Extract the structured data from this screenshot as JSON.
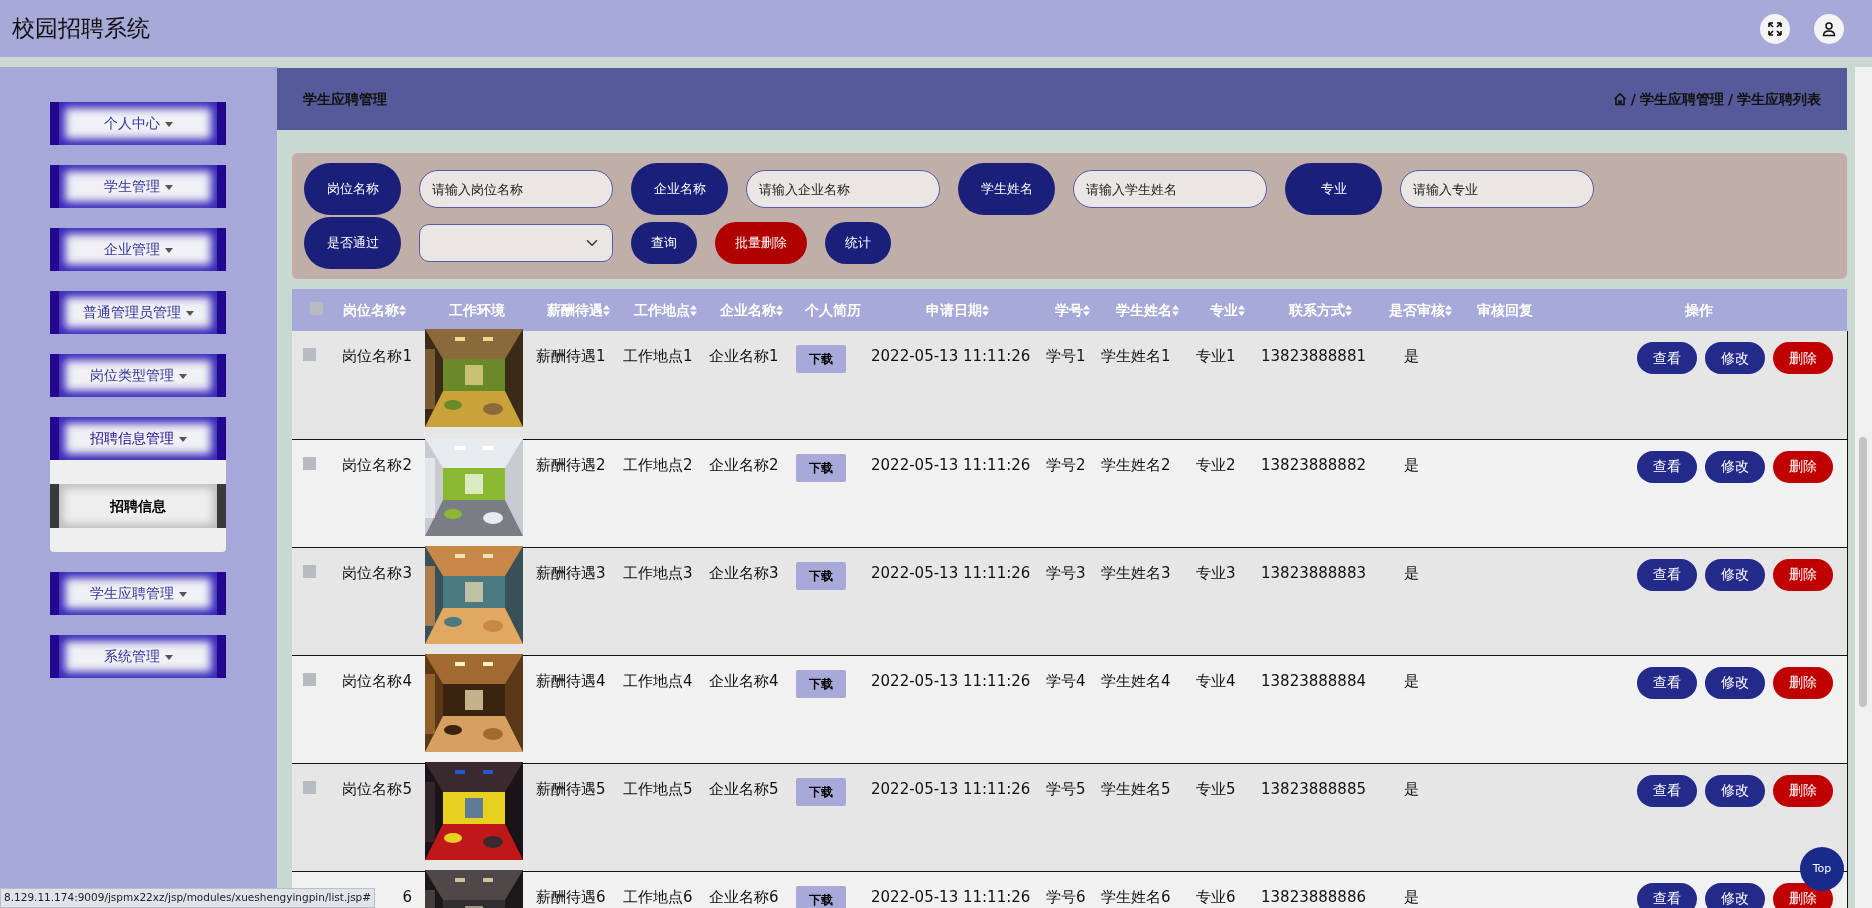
{
  "app_title": "校园招聘系统",
  "sidebar": {
    "menus": [
      {
        "label": "个人中心"
      },
      {
        "label": "学生管理"
      },
      {
        "label": "企业管理"
      },
      {
        "label": "普通管理员管理"
      },
      {
        "label": "岗位类型管理"
      },
      {
        "label": "招聘信息管理",
        "children": [
          {
            "label": "招聘信息",
            "hovered": true
          }
        ]
      },
      {
        "label": "学生应聘管理"
      },
      {
        "label": "系统管理"
      }
    ]
  },
  "page_header": {
    "title": "学生应聘管理",
    "separator": "/",
    "breadcrumb": [
      "学生应聘管理",
      "学生应聘列表"
    ]
  },
  "filters": [
    {
      "label": "岗位名称",
      "kind": "text",
      "placeholder": "请输入岗位名称"
    },
    {
      "label": "企业名称",
      "kind": "text",
      "placeholder": "请输入企业名称"
    },
    {
      "label": "学生姓名",
      "kind": "text",
      "placeholder": "请输入学生姓名"
    },
    {
      "label": "专业",
      "kind": "text",
      "placeholder": "请输入专业"
    },
    {
      "label": "是否通过",
      "kind": "select"
    }
  ],
  "filter_buttons": [
    {
      "label": "查询",
      "kind": "primary"
    },
    {
      "label": "批量删除",
      "kind": "danger"
    },
    {
      "label": "统计",
      "kind": "primary"
    }
  ],
  "table": {
    "select_all_checked": false,
    "columns": [
      {
        "label": "岗位名称",
        "sortable": true
      },
      {
        "label": "工作环境",
        "sortable": false
      },
      {
        "label": "薪酬待遇",
        "sortable": true
      },
      {
        "label": "工作地点",
        "sortable": true
      },
      {
        "label": "企业名称",
        "sortable": true
      },
      {
        "label": "个人简历",
        "sortable": false
      },
      {
        "label": "申请日期",
        "sortable": true
      },
      {
        "label": "学号",
        "sortable": true
      },
      {
        "label": "学生姓名",
        "sortable": true
      },
      {
        "label": "专业",
        "sortable": true
      },
      {
        "label": "联系方式",
        "sortable": true
      },
      {
        "label": "是否审核",
        "sortable": true
      },
      {
        "label": "审核回复",
        "sortable": false
      },
      {
        "label": "操作",
        "sortable": false
      }
    ],
    "rows": [
      {
        "checked": false,
        "post": "岗位名称1",
        "salary": "薪酬待遇1",
        "location": "工作地点1",
        "company": "企业名称1",
        "resume": "下载",
        "date": "2022-05-13 11:11:26",
        "student_no": "学号1",
        "student_name": "学生姓名1",
        "major": "专业1",
        "phone": "13823888881",
        "reviewed": "是",
        "actions": [
          {
            "label": "查看",
            "kind": "primary"
          },
          {
            "label": "修改",
            "kind": "primary"
          },
          {
            "label": "删除",
            "kind": "danger"
          }
        ]
      },
      {
        "checked": false,
        "post": "岗位名称2",
        "salary": "薪酬待遇2",
        "location": "工作地点2",
        "company": "企业名称2",
        "resume": "下载",
        "date": "2022-05-13 11:11:26",
        "student_no": "学号2",
        "student_name": "学生姓名2",
        "major": "专业2",
        "phone": "13823888882",
        "reviewed": "是",
        "actions": [
          {
            "label": "查看",
            "kind": "primary"
          },
          {
            "label": "修改",
            "kind": "primary"
          },
          {
            "label": "删除",
            "kind": "danger"
          }
        ]
      },
      {
        "checked": false,
        "post": "岗位名称3",
        "salary": "薪酬待遇3",
        "location": "工作地点3",
        "company": "企业名称3",
        "resume": "下载",
        "date": "2022-05-13 11:11:26",
        "student_no": "学号3",
        "student_name": "学生姓名3",
        "major": "专业3",
        "phone": "13823888883",
        "reviewed": "是",
        "actions": [
          {
            "label": "查看",
            "kind": "primary"
          },
          {
            "label": "修改",
            "kind": "primary"
          },
          {
            "label": "删除",
            "kind": "danger"
          }
        ]
      },
      {
        "checked": false,
        "post": "岗位名称4",
        "salary": "薪酬待遇4",
        "location": "工作地点4",
        "company": "企业名称4",
        "resume": "下载",
        "date": "2022-05-13 11:11:26",
        "student_no": "学号4",
        "student_name": "学生姓名4",
        "major": "专业4",
        "phone": "13823888884",
        "reviewed": "是",
        "actions": [
          {
            "label": "查看",
            "kind": "primary"
          },
          {
            "label": "修改",
            "kind": "primary"
          },
          {
            "label": "删除",
            "kind": "danger"
          }
        ]
      },
      {
        "checked": false,
        "post": "岗位名称5",
        "salary": "薪酬待遇5",
        "location": "工作地点5",
        "company": "企业名称5",
        "resume": "下载",
        "date": "2022-05-13 11:11:26",
        "student_no": "学号5",
        "student_name": "学生姓名5",
        "major": "专业5",
        "phone": "13823888885",
        "reviewed": "是",
        "actions": [
          {
            "label": "查看",
            "kind": "primary"
          },
          {
            "label": "修改",
            "kind": "primary"
          },
          {
            "label": "删除",
            "kind": "danger"
          }
        ]
      },
      {
        "post": "6",
        "salary": "薪酬待遇6",
        "location": "工作地点6",
        "company": "企业名称6",
        "resume": "下载",
        "date": "2022-05-13 11:11:26",
        "student_no": "学号6",
        "student_name": "学生姓名6",
        "major": "专业6",
        "phone": "13823888886",
        "reviewed": "是",
        "actions": [
          {
            "label": "查看",
            "kind": "primary"
          },
          {
            "label": "修改",
            "kind": "primary"
          },
          {
            "label": "删除",
            "kind": "danger"
          }
        ]
      }
    ]
  },
  "status_url": "8.129.11.174:9009/jspmx22xz/jsp/modules/xueshengyingpin/list.jsp#",
  "top_button": "Top"
}
